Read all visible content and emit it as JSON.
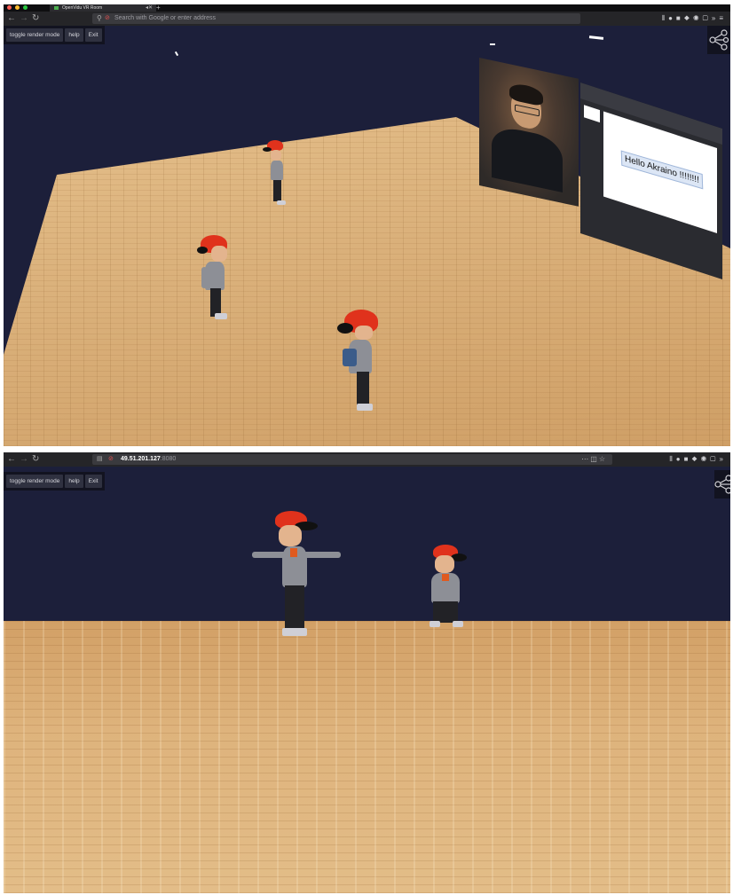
{
  "screenshot_top": {
    "tab_title": "OpenVidu VR Room",
    "address_placeholder": "Search with Google or enter address",
    "buttons": {
      "toggle": "toggle render mode",
      "help": "help",
      "exit": "Exit"
    },
    "slide_text": "Hello Akraino !!!!!!!!"
  },
  "screenshot_bottom": {
    "url_host": "49.51.201.127",
    "url_port": ":8080",
    "buttons": {
      "toggle": "toggle render mode",
      "help": "help",
      "exit": "Exit"
    }
  },
  "colors": {
    "sky": "#1c1f3a",
    "floor": "#dab07a",
    "cap": "#e0321c",
    "chrome": "#252528"
  },
  "icons": [
    "back-icon",
    "forward-icon",
    "reload-icon",
    "search-icon",
    "share-network-icon",
    "library-icon",
    "overflow-icon",
    "menu-icon"
  ]
}
